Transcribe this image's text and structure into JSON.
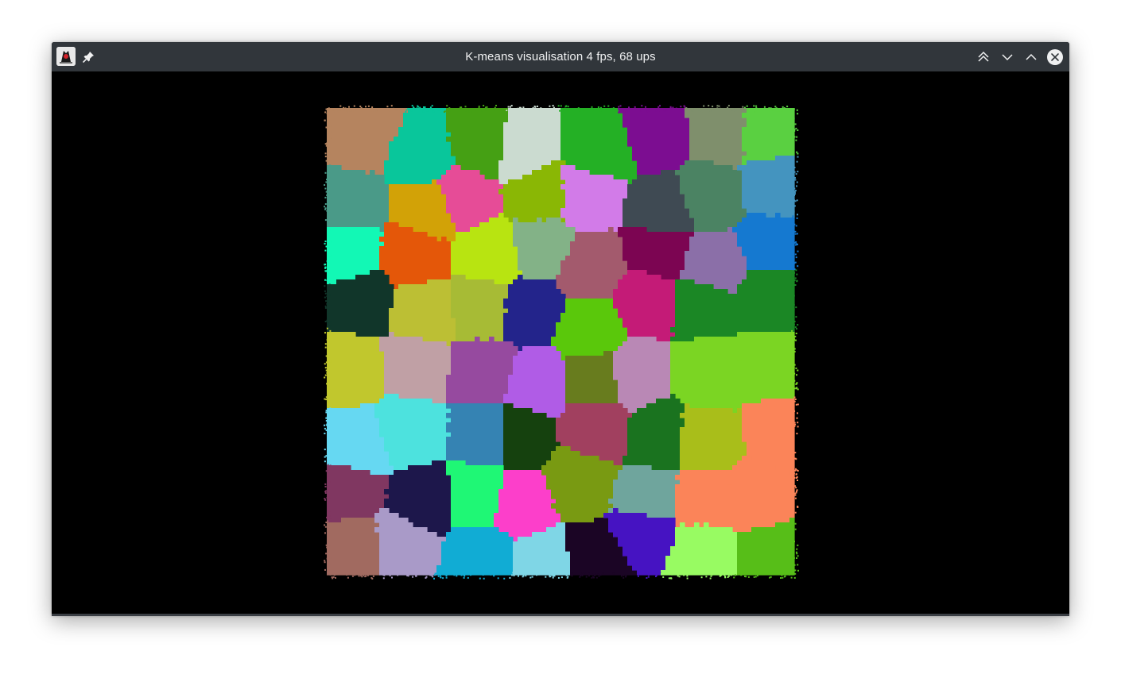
{
  "window": {
    "title": "K-means visualisation 4 fps, 68 ups",
    "icons": {
      "app": "java-duke-icon",
      "pin": "pin-icon",
      "keep_above": "keep-above-icon",
      "minimize": "minimize-icon",
      "maximize": "maximize-icon",
      "close": "close-icon"
    }
  },
  "visualisation": {
    "cluster_count": 64,
    "cluster_colors": [
      "#b5845f",
      "#09c69b",
      "#45a014",
      "#cbdbd0",
      "#24b025",
      "#7c0d91",
      "#7f8f6c",
      "#5ad041",
      "#4a9a88",
      "#d2a207",
      "#e64c97",
      "#8ab705",
      "#d27be8",
      "#3f4a53",
      "#4b8363",
      "#4494bf",
      "#12f8b5",
      "#e45709",
      "#b8e411",
      "#83b287",
      "#a35a6d",
      "#7c0552",
      "#8b6fa8",
      "#1579d0",
      "#11362a",
      "#bcbf34",
      "#a7bb35",
      "#23248b",
      "#5ac80b",
      "#c41b77",
      "#1b8725",
      "#1b8725",
      "#c1c72d",
      "#c0a0a5",
      "#964a9f",
      "#b05ce6",
      "#687c1e",
      "#b988b5",
      "#7bd523",
      "#7bd523",
      "#66d8f2",
      "#4de2de",
      "#3583b3",
      "#15410e",
      "#a1405f",
      "#1a731f",
      "#a9be1a",
      "#fb8459",
      "#803761",
      "#1d174b",
      "#1ff775",
      "#fc3fca",
      "#799a12",
      "#6fa59d",
      "#fb8459",
      "#fb8459",
      "#a16a60",
      "#a99ac8",
      "#11acd4",
      "#7fd6e6",
      "#1b0525",
      "#4613c2",
      "#98fb62",
      "#57be18"
    ],
    "edge_cluster_color": "#442450"
  }
}
